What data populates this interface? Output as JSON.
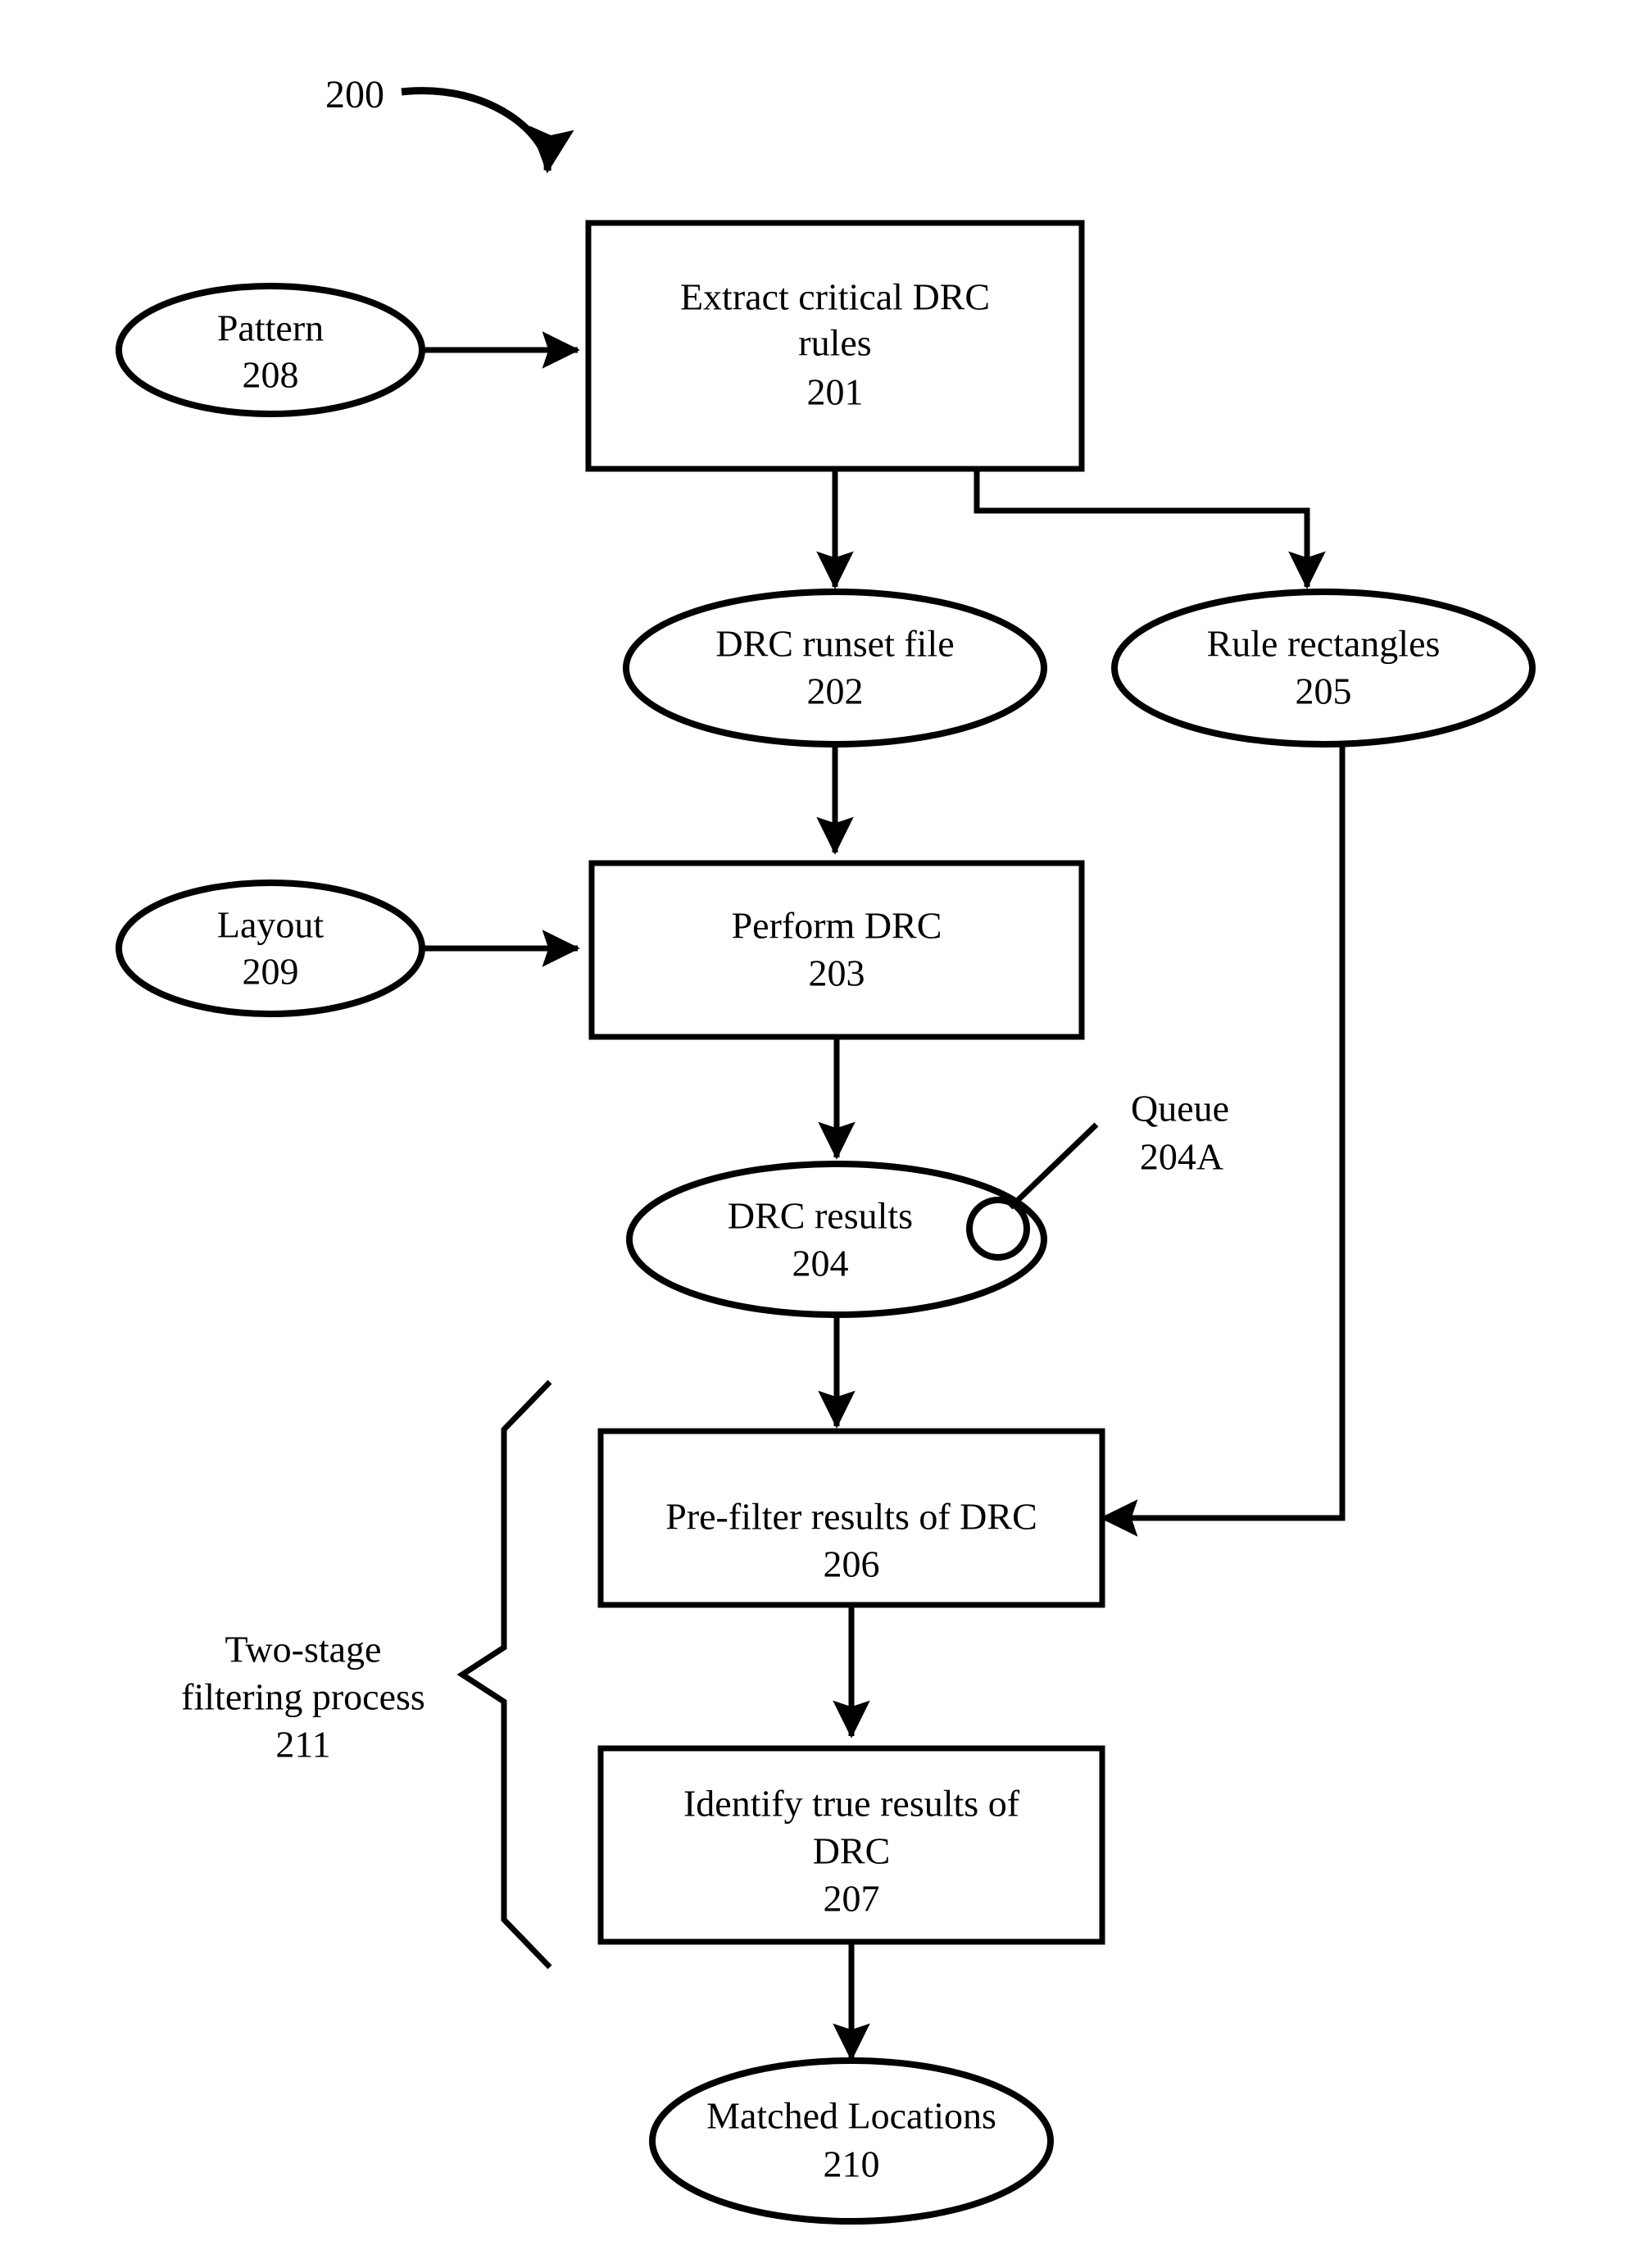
{
  "figure": {
    "number": "200",
    "type": "patent-flowchart"
  },
  "nodes": {
    "pattern": {
      "label": "Pattern",
      "ref": "208",
      "shape": "ellipse"
    },
    "extract": {
      "label_line1": "Extract critical DRC",
      "label_line2": "rules",
      "ref": "201",
      "shape": "rectangle"
    },
    "runset": {
      "label": "DRC runset file",
      "ref": "202",
      "shape": "ellipse"
    },
    "rulerects": {
      "label": "Rule rectangles",
      "ref": "205",
      "shape": "ellipse"
    },
    "layout": {
      "label": "Layout",
      "ref": "209",
      "shape": "ellipse"
    },
    "performdrc": {
      "label": "Perform DRC",
      "ref": "203",
      "shape": "rectangle"
    },
    "drcresults": {
      "label": "DRC results",
      "ref": "204",
      "shape": "ellipse"
    },
    "queue": {
      "label": "Queue",
      "ref": "204A",
      "shape": "callout"
    },
    "prefilter": {
      "label_line1": "Pre-filter results of DRC",
      "ref": "206",
      "shape": "rectangle"
    },
    "identify": {
      "label_line1": "Identify true results of",
      "label_line2": "DRC",
      "ref": "207",
      "shape": "rectangle"
    },
    "matched": {
      "label": "Matched Locations",
      "ref": "210",
      "shape": "ellipse"
    },
    "twostage": {
      "label_line1": "Two-stage",
      "label_line2": "filtering process",
      "ref": "211",
      "shape": "brace-label"
    }
  },
  "colors": {
    "stroke": "#000000",
    "fill": "#ffffff",
    "background": "#ffffff"
  }
}
